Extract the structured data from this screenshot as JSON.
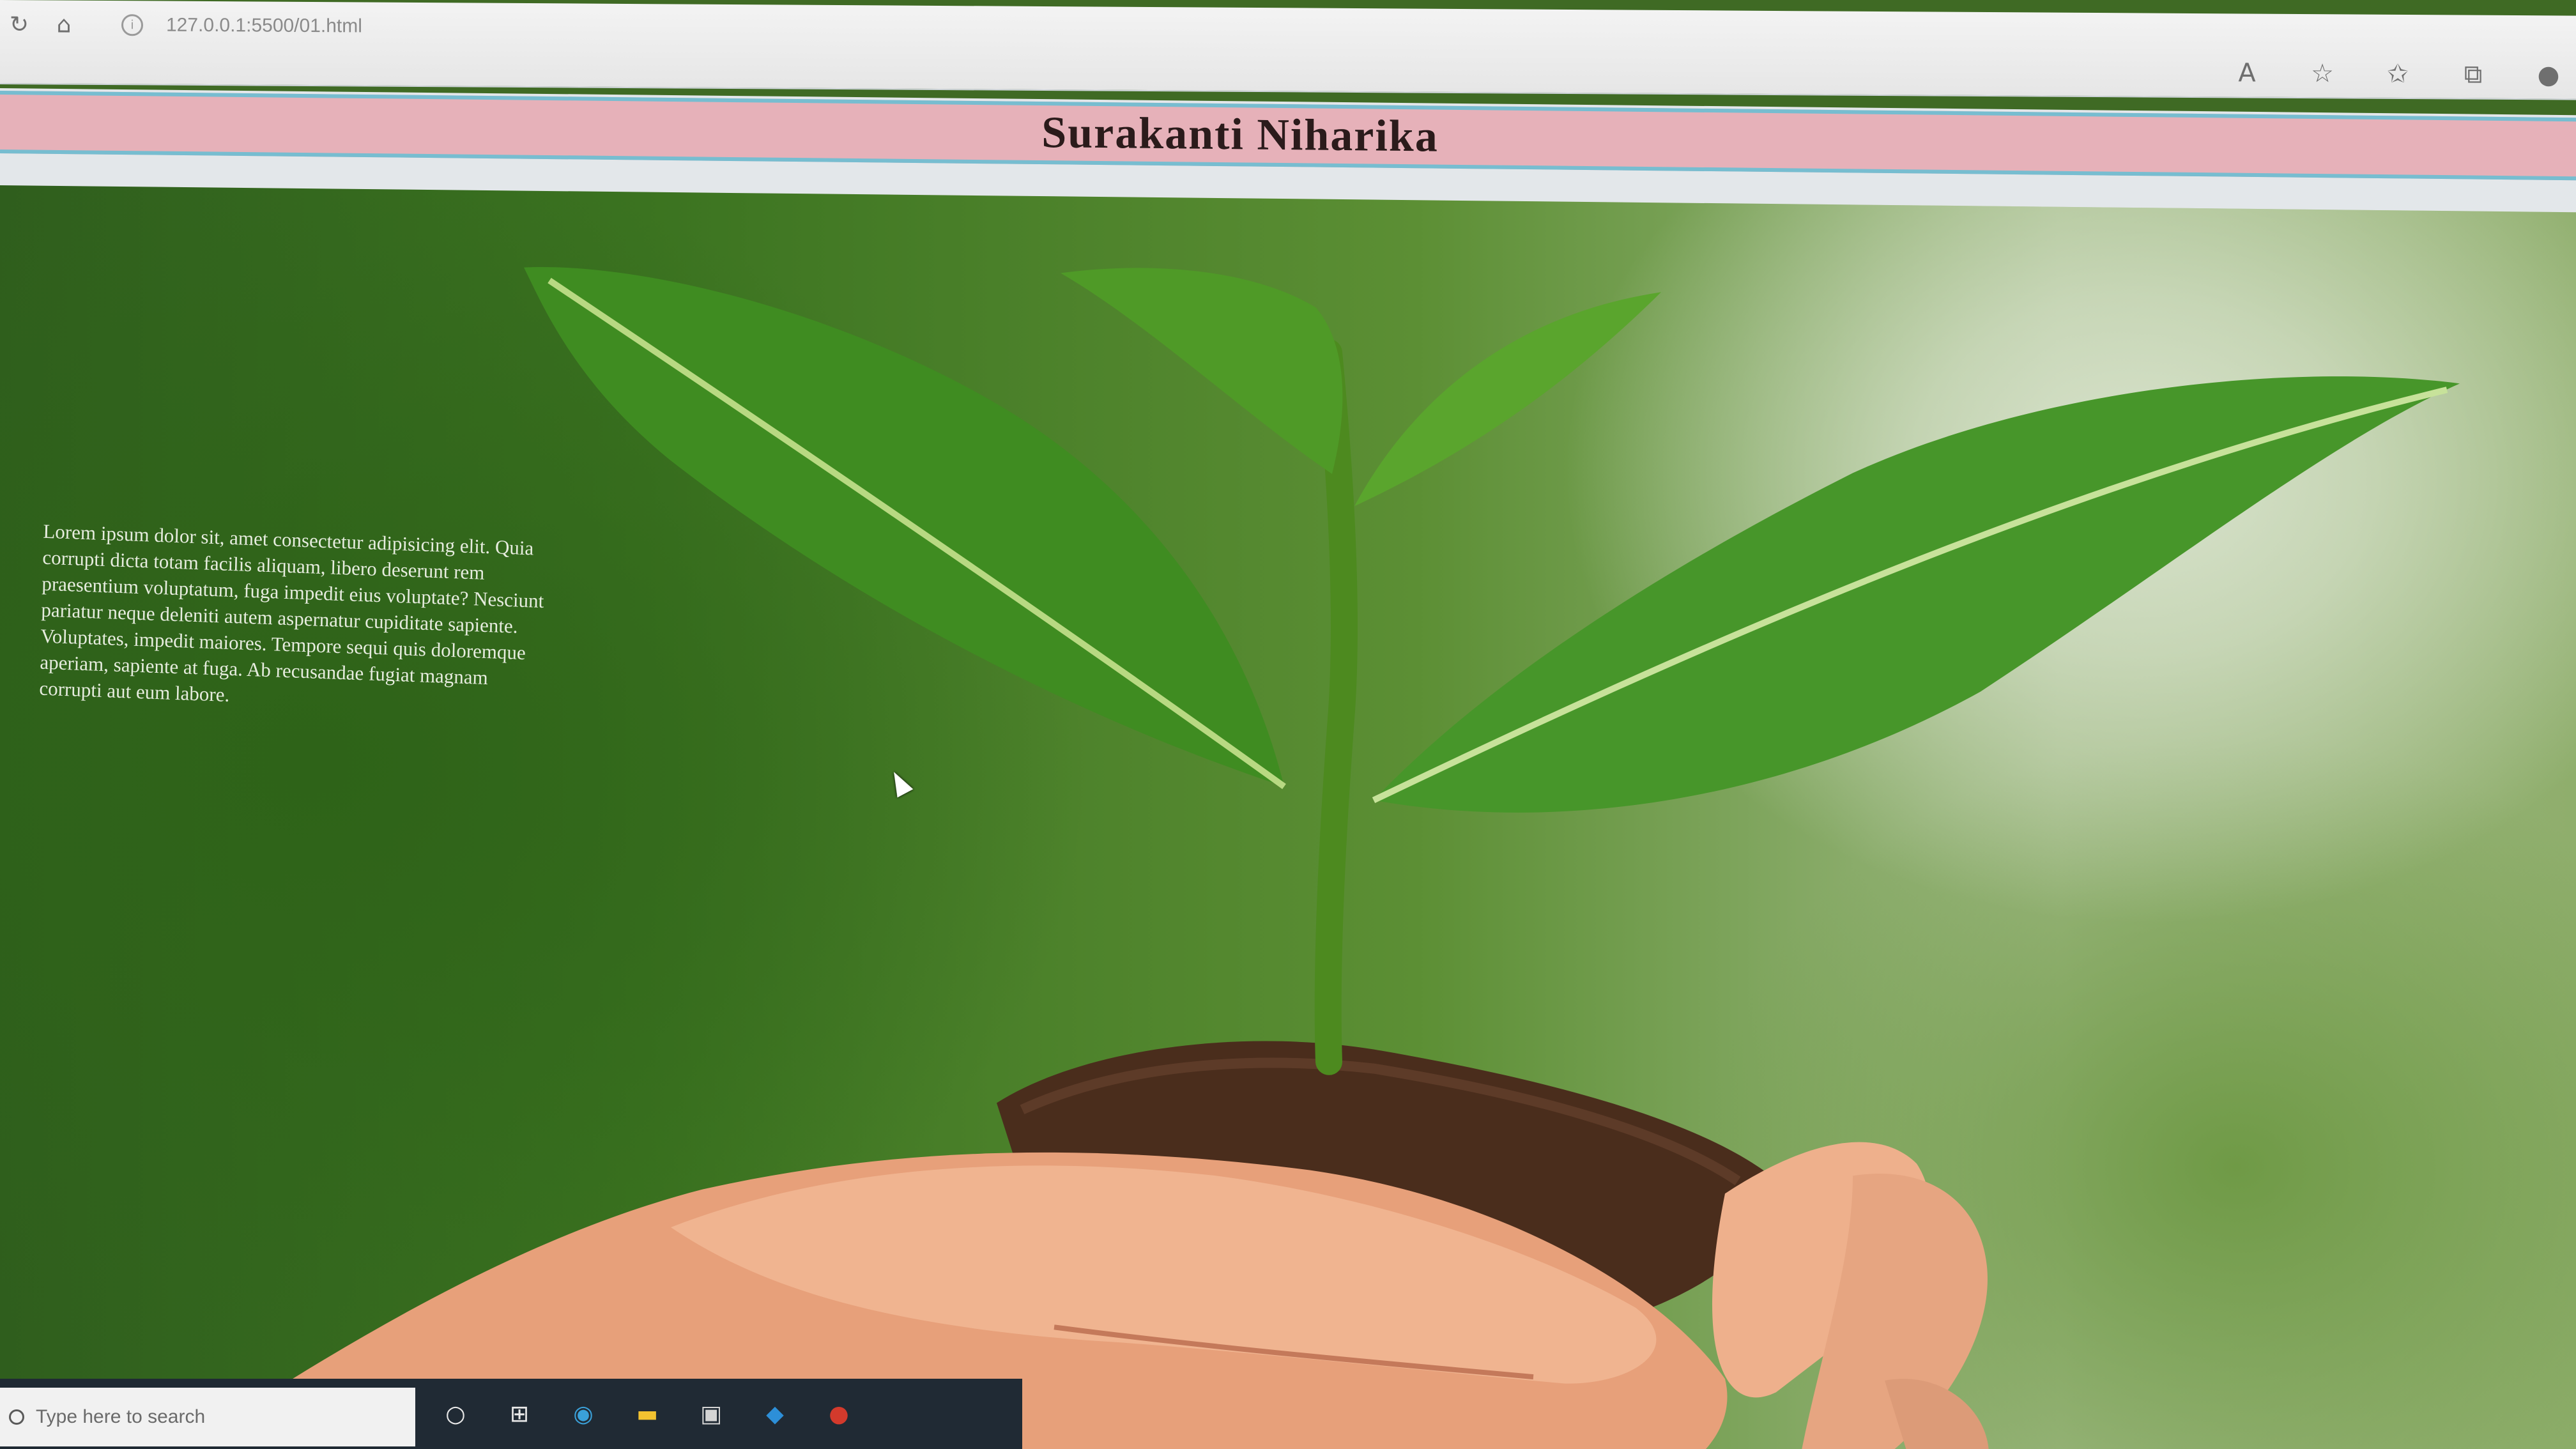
{
  "browser": {
    "url": "127.0.0.1:5500/01.html",
    "icons": [
      "refresh-icon",
      "home-icon",
      "info-icon",
      "read-aloud-icon",
      "add-favorite-icon",
      "favorites-icon",
      "collections-icon",
      "profile-icon"
    ]
  },
  "page": {
    "title": "Surakanti Niharika",
    "paragraph": "Lorem ipsum dolor sit, amet consectetur adipisicing elit. Quia corrupti dicta totam facilis aliquam, libero deserunt rem praesentium voluptatum, fuga impedit eius voluptate? Nesciunt pariatur neque deleniti autem aspernatur cupiditate sapiente. Voluptates, impedit maiores. Tempore sequi quis doloremque aperiam, sapiente at fuga. Ab recusandae fugiat magnam corrupti aut eum labore."
  },
  "taskbar": {
    "search_placeholder": "Type here to search"
  },
  "colors": {
    "header_pink": "#e6b1b9",
    "header_border": "#77bdd0",
    "title_text": "#2b1b1b"
  }
}
